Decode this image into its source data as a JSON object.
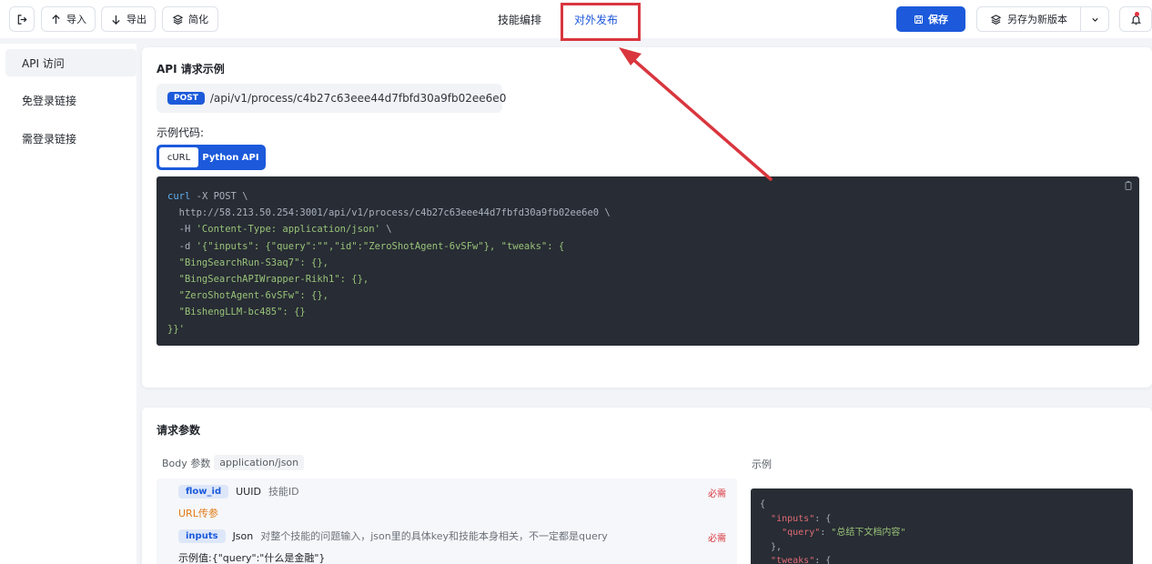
{
  "toolbar": {
    "import_label": "导入",
    "export_label": "导出",
    "simplify_label": "简化",
    "tabs": [
      {
        "label": "技能编排"
      },
      {
        "label": "对外发布"
      }
    ],
    "save_label": "保存",
    "save_as_label": "另存为新版本"
  },
  "sidebar": {
    "items": [
      {
        "label": "API 访问"
      },
      {
        "label": "免登录链接"
      },
      {
        "label": "需登录链接"
      }
    ]
  },
  "api_example": {
    "title": "API 请求示例",
    "method": "POST",
    "endpoint": "/api/v1/process/c4b27c63eee44d7fbfd30a9fb02ee6e0",
    "code_label": "示例代码:",
    "code_tabs": [
      {
        "label": "cURL"
      },
      {
        "label": "Python API"
      }
    ],
    "code": {
      "cmd": "curl",
      "line1_rest": " -X POST \\",
      "line2": "  http://58.213.50.254:3001/api/v1/process/c4b27c63eee44d7fbfd30a9fb02ee6e0 \\",
      "line3_flag": "  -H ",
      "line3_str": "'Content-Type: application/json'",
      "line3_end": " \\",
      "line4_flag": "  -d ",
      "line4_str": "'{\"inputs\": {\"query\":\"\",\"id\":\"ZeroShotAgent-6vSFw\"}, \"tweaks\": {",
      "line5": "  \"BingSearchRun-S3aq7\": {},",
      "line6": "  \"BingSearchAPIWrapper-Rikh1\": {},",
      "line7": "  \"ZeroShotAgent-6vSFw\": {},",
      "line8": "  \"BishengLLM-bc485\": {}",
      "line9": "}}'"
    }
  },
  "request_params": {
    "title": "请求参数",
    "body_label": "Body 参数",
    "content_type": "application/json",
    "example_label": "示例",
    "params": [
      {
        "name": "flow_id",
        "type": "UUID",
        "desc": "技能ID",
        "required": "必需",
        "note": "URL传参"
      },
      {
        "name": "inputs",
        "type": "Json",
        "desc": "对整个技能的问题输入，json里的具体key和技能本身相关，不一定都是query",
        "required": "必需",
        "example_prefix": "示例值:",
        "example_value": "{\"query\":\"什么是金融\"}"
      }
    ],
    "example_code": {
      "l1": "{",
      "l2_key": "\"inputs\"",
      "l2_rest": ": {",
      "l3_key": "\"query\"",
      "l3_sep": ": ",
      "l3_val": "\"总结下文档内容\"",
      "l4": "  },",
      "l5_key": "\"tweaks\"",
      "l5_rest": ": {"
    }
  },
  "colors": {
    "primary": "#1c5adb",
    "highlight": "#d9363e",
    "code_bg": "#282c34"
  }
}
